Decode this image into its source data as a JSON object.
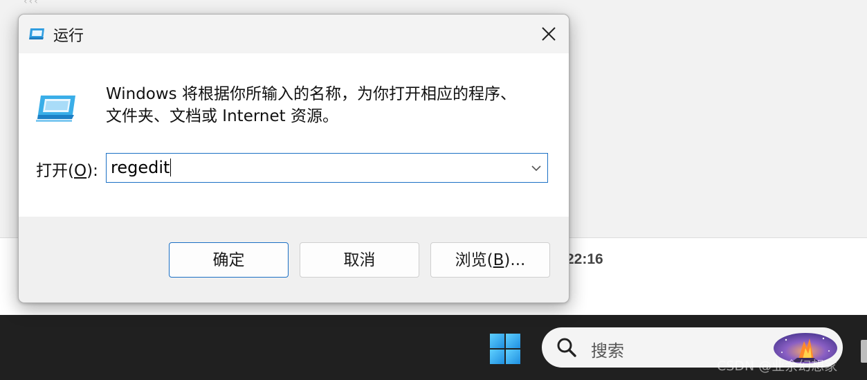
{
  "background": {
    "time_text": "22:16",
    "top_marks": "‹‹‹"
  },
  "dialog": {
    "title": "运行",
    "description_line1": "Windows 将根据你所输入的名称，为你打开相应的程序、",
    "description_line2": "文件夹、文档或 Internet 资源。",
    "open_label_pre": "打开(",
    "open_label_key": "O",
    "open_label_post": "):",
    "open_value": "regedit",
    "buttons": {
      "ok": "确定",
      "cancel": "取消",
      "browse_pre": "浏览(",
      "browse_key": "B",
      "browse_post": ")..."
    }
  },
  "taskbar": {
    "search_placeholder": "搜索"
  },
  "watermark": "CSDN @业余幻想家",
  "colors": {
    "accent": "#1a6fc4",
    "taskbar": "#202020",
    "start_icon": "#3fb6f2",
    "run_icon": "#3aaee8"
  },
  "icons": {
    "title": "run-icon",
    "close": "close-icon",
    "combo": "chevron-down-icon",
    "start": "windows-start-icon",
    "search": "search-icon"
  }
}
